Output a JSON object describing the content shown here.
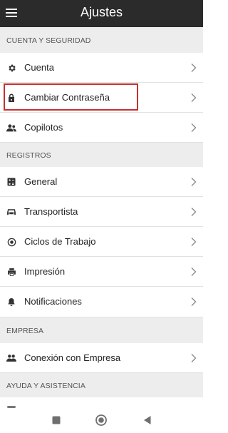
{
  "header": {
    "title": "Ajustes",
    "menu_icon": "hamburger-menu-icon"
  },
  "sections": [
    {
      "title": "CUENTA Y SEGURIDAD",
      "items": [
        {
          "label": "Cuenta",
          "icon": "gear-icon"
        },
        {
          "label": "Cambiar Contraseña",
          "icon": "lock-icon"
        },
        {
          "label": "Copilotos",
          "icon": "copilot-users-icon"
        }
      ]
    },
    {
      "title": "REGISTROS",
      "items": [
        {
          "label": "General",
          "icon": "calculator-icon"
        },
        {
          "label": "Transportista",
          "icon": "truck-icon"
        },
        {
          "label": "Ciclos de Trabajo",
          "icon": "target-icon"
        },
        {
          "label": "Impresión",
          "icon": "printer-icon"
        },
        {
          "label": "Notificaciones",
          "icon": "bell-icon"
        }
      ]
    },
    {
      "title": "EMPRESA",
      "items": [
        {
          "label": "Conexión con Empresa",
          "icon": "people-icon"
        }
      ]
    },
    {
      "title": "AYUDA Y ASISTENCIA",
      "items": []
    }
  ],
  "highlight_color": "#c62f2f",
  "nav": {
    "recent_icon": "square-icon",
    "home_icon": "circle-home-icon",
    "back_icon": "triangle-back-icon"
  }
}
